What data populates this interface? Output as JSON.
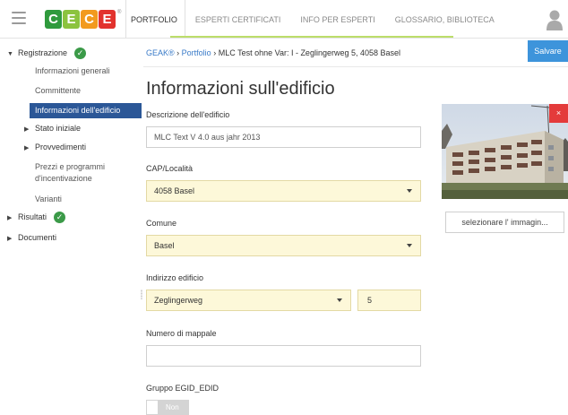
{
  "colors": {
    "accent_blue": "#3d94db",
    "nav_active": "#2b5797",
    "field_yellow": "#fdf8d9",
    "status_green": "#3b9a48",
    "close_red": "#e43b3b",
    "tab_underline": "#bcdd6a"
  },
  "logo": {
    "letters": [
      {
        "char": "C",
        "color": "#2f9a3d"
      },
      {
        "char": "E",
        "color": "#8cc33f"
      },
      {
        "char": "C",
        "color": "#f29a1f"
      },
      {
        "char": "E",
        "color": "#e2322d"
      }
    ],
    "reg": "®"
  },
  "tabs": [
    {
      "label": "PORTFOLIO"
    },
    {
      "label": "ESPERTI CERTIFICATI"
    },
    {
      "label": "INFO PER ESPERTI"
    },
    {
      "label": "GLOSSARIO, BIBLIOTECA"
    }
  ],
  "sidebar": {
    "registrazione": "Registrazione",
    "informazioni_generali": "Informazioni generali",
    "committente": "Committente",
    "informazioni_edificio": "Informazioni dell'edificio",
    "stato_iniziale": "Stato iniziale",
    "provvedimenti": "Provvedimenti",
    "prezzi_line1": "Prezzi e programmi",
    "prezzi_line2": "d'incentivazione",
    "varianti": "Varianti",
    "risultati": "Risultati",
    "documenti": "Documenti"
  },
  "breadcrumb": {
    "geak": "GEAK®",
    "sep": "›",
    "portfolio": "Portfolio",
    "current": "MLC Test ohne Var: I - Zeglingerweg 5, 4058 Basel"
  },
  "save_label": "Salvare",
  "page_title": "Informazioni sull'edificio",
  "form": {
    "descrizione_label": "Descrizione dell'edificio",
    "descrizione_value": "MLC Text V 4.0 aus jahr 2013",
    "cap_label": "CAP/Località",
    "cap_value": "4058 Basel",
    "comune_label": "Comune",
    "comune_value": "Basel",
    "indirizzo_label": "Indirizzo edificio",
    "strada_value": "Zeglingerweg",
    "numero_value": "5",
    "mappale_label": "Numero di mappale",
    "mappale_value": "",
    "egid_label": "Gruppo EGID_EDID",
    "toggle_label": "Non"
  },
  "photo": {
    "close_label": "×",
    "select_button": "selezionare l' immagin..."
  }
}
